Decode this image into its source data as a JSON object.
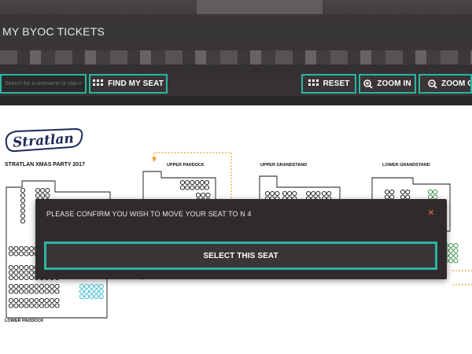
{
  "app": {
    "title": "MY BYOC TICKETS"
  },
  "toolbar": {
    "search_placeholder": "Search for a nickname or clan name...",
    "find_label": "FIND MY SEAT",
    "reset_label": "RESET",
    "zoom_in_label": "ZOOM IN",
    "zoom_out_label": "ZOOM OUT"
  },
  "map": {
    "logo_text": "Stratlan",
    "event_name": "STRATLAN XMAS PARTY 2017",
    "sections": {
      "upper_paddock": "UPPER PADDOCK",
      "upper_grandstand": "UPPER GRANDSTAND",
      "lower_grandstand": "LOWER GRANDSTAND",
      "lower_paddock": "LOWER PADDOCK"
    }
  },
  "modal": {
    "message": "PLEASE CONFIRM YOU WISH TO MOVE YOUR SEAT TO N 4",
    "close_icon": "×",
    "select_label": "SELECT THIS SEAT"
  },
  "colors": {
    "accent": "#2bb5a1",
    "header_bg": "#3a3637",
    "modal_bg": "#2f2b2c",
    "close": "#e25b3f",
    "seat_available_green": "#2e8b3a",
    "seat_cyan": "#2bb5c8",
    "path_orange": "#f0a030",
    "logo_navy": "#1f2a5a"
  }
}
